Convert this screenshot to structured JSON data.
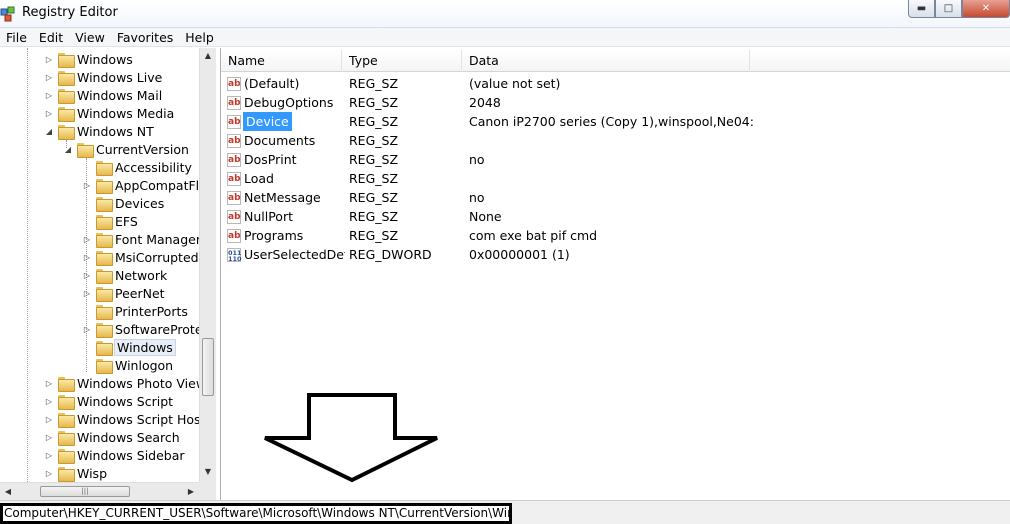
{
  "window": {
    "title": "Registry Editor"
  },
  "menu": [
    "File",
    "Edit",
    "View",
    "Favorites",
    "Help"
  ],
  "tree": [
    {
      "label": "Windows",
      "level": 0,
      "expander": "collapsed"
    },
    {
      "label": "Windows Live",
      "level": 0,
      "expander": "collapsed"
    },
    {
      "label": "Windows Mail",
      "level": 0,
      "expander": "collapsed"
    },
    {
      "label": "Windows Media",
      "level": 0,
      "expander": "collapsed"
    },
    {
      "label": "Windows NT",
      "level": 0,
      "expander": "expanded"
    },
    {
      "label": "CurrentVersion",
      "level": 1,
      "expander": "expanded"
    },
    {
      "label": "Accessibility",
      "level": 2,
      "expander": "none"
    },
    {
      "label": "AppCompatFlags",
      "level": 2,
      "expander": "collapsed"
    },
    {
      "label": "Devices",
      "level": 2,
      "expander": "none"
    },
    {
      "label": "EFS",
      "level": 2,
      "expander": "none"
    },
    {
      "label": "Font Management",
      "level": 2,
      "expander": "collapsed"
    },
    {
      "label": "MsiCorruptedFileRecovery",
      "level": 2,
      "expander": "collapsed"
    },
    {
      "label": "Network",
      "level": 2,
      "expander": "collapsed"
    },
    {
      "label": "PeerNet",
      "level": 2,
      "expander": "collapsed"
    },
    {
      "label": "PrinterPorts",
      "level": 2,
      "expander": "none"
    },
    {
      "label": "SoftwareProtectionPlatform",
      "level": 2,
      "expander": "collapsed"
    },
    {
      "label": "Windows",
      "level": 2,
      "expander": "none",
      "selected": true
    },
    {
      "label": "Winlogon",
      "level": 2,
      "expander": "none"
    },
    {
      "label": "Windows Photo Viewer",
      "level": 0,
      "expander": "collapsed"
    },
    {
      "label": "Windows Script",
      "level": 0,
      "expander": "collapsed"
    },
    {
      "label": "Windows Script Host",
      "level": 0,
      "expander": "collapsed"
    },
    {
      "label": "Windows Search",
      "level": 0,
      "expander": "collapsed"
    },
    {
      "label": "Windows Sidebar",
      "level": 0,
      "expander": "collapsed"
    },
    {
      "label": "Wisp",
      "level": 0,
      "expander": "collapsed"
    }
  ],
  "list": {
    "columns": {
      "name": "Name",
      "type": "Type",
      "data": "Data"
    },
    "rows": [
      {
        "name": "(Default)",
        "type": "REG_SZ",
        "data": "(value not set)",
        "icon": "ab-string-icon"
      },
      {
        "name": "DebugOptions",
        "type": "REG_SZ",
        "data": "2048",
        "icon": "ab-string-icon"
      },
      {
        "name": "Device",
        "type": "REG_SZ",
        "data": "Canon iP2700 series (Copy 1),winspool,Ne04:",
        "icon": "ab-string-icon",
        "selected": true
      },
      {
        "name": "Documents",
        "type": "REG_SZ",
        "data": "",
        "icon": "ab-string-icon"
      },
      {
        "name": "DosPrint",
        "type": "REG_SZ",
        "data": "no",
        "icon": "ab-string-icon"
      },
      {
        "name": "Load",
        "type": "REG_SZ",
        "data": "",
        "icon": "ab-string-icon"
      },
      {
        "name": "NetMessage",
        "type": "REG_SZ",
        "data": "no",
        "icon": "ab-string-icon"
      },
      {
        "name": "NullPort",
        "type": "REG_SZ",
        "data": "None",
        "icon": "ab-string-icon"
      },
      {
        "name": "Programs",
        "type": "REG_SZ",
        "data": "com exe bat pif cmd",
        "icon": "ab-string-icon"
      },
      {
        "name": "UserSelectedDef...",
        "type": "REG_DWORD",
        "data": "0x00000001 (1)",
        "icon": "binary-dword-icon"
      }
    ]
  },
  "statusbar": {
    "path": "Computer\\HKEY_CURRENT_USER\\Software\\Microsoft\\Windows NT\\CurrentVersion\\Windows"
  },
  "colors": {
    "selection": "#3399ff",
    "folder": "#e6b84c",
    "string_icon": "#c0392b",
    "dword_icon": "#2450a5"
  }
}
